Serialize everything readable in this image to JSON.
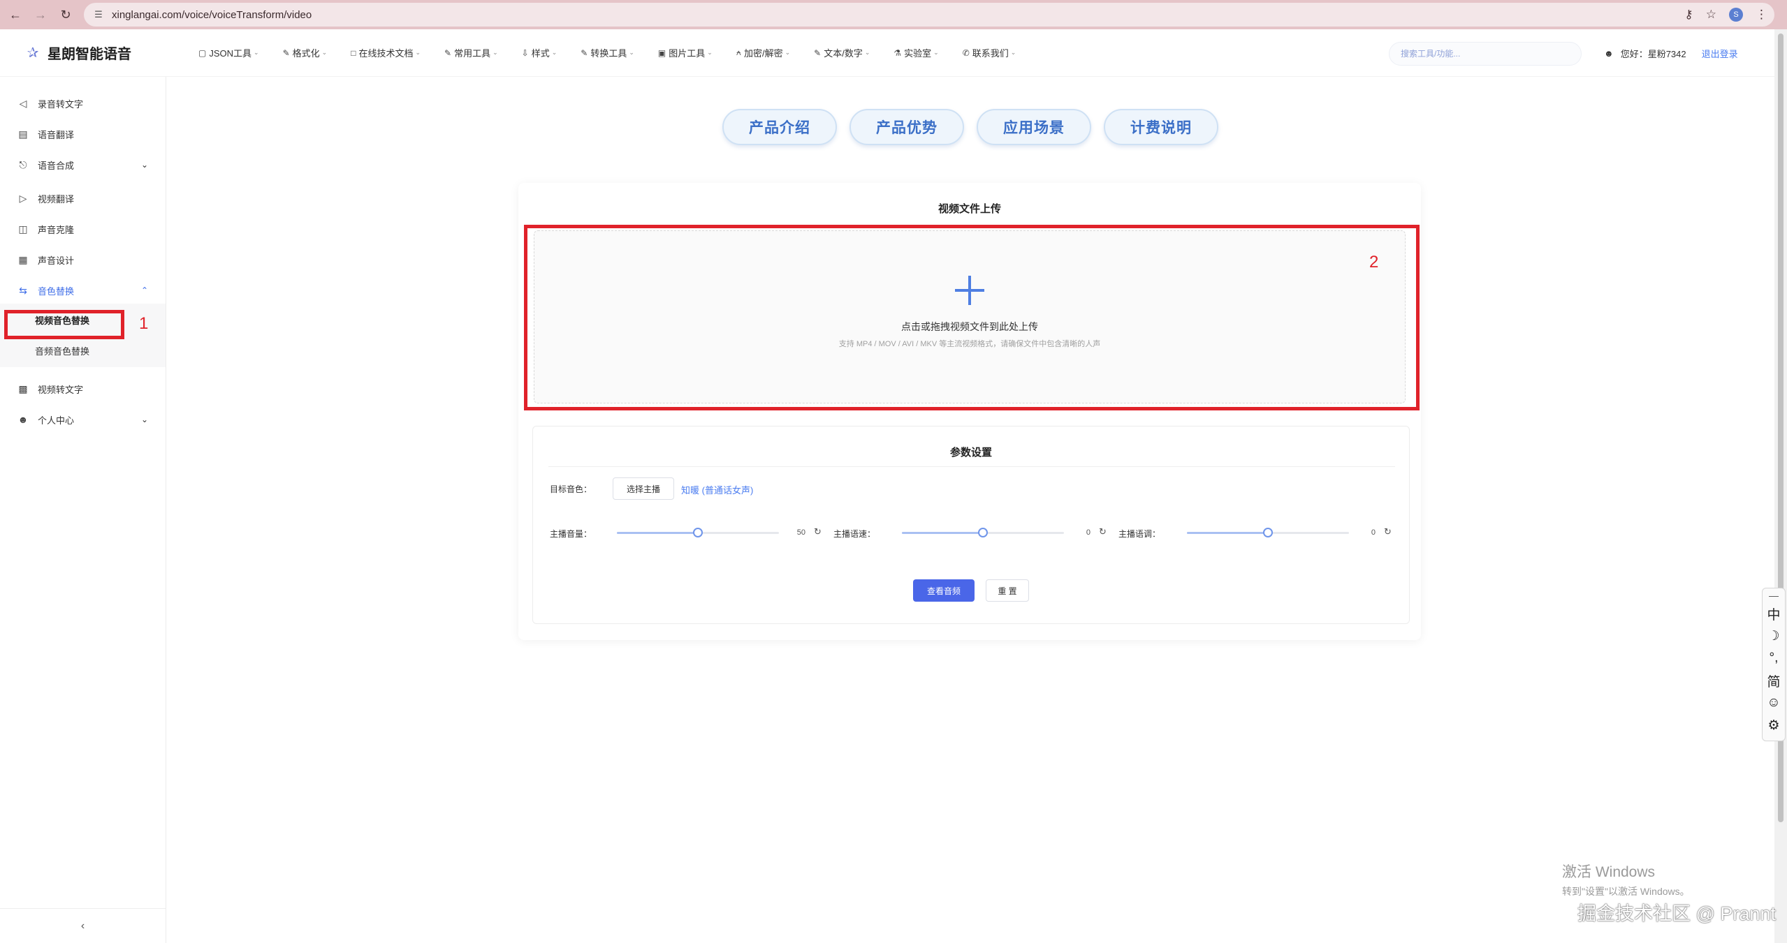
{
  "browser": {
    "url": "xinglangai.com/voice/voiceTransform/video",
    "profile_initial": "S"
  },
  "header": {
    "logo_text": "星朗智能语音",
    "nav": [
      {
        "label": "JSON工具",
        "icon": "json-icon"
      },
      {
        "label": "格式化",
        "icon": "format-icon"
      },
      {
        "label": "在线技术文档",
        "icon": "doc-icon"
      },
      {
        "label": "常用工具",
        "icon": "tools-icon"
      },
      {
        "label": "样式",
        "icon": "style-icon"
      },
      {
        "label": "转换工具",
        "icon": "convert-icon"
      },
      {
        "label": "图片工具",
        "icon": "image-icon"
      },
      {
        "label": "加密/解密",
        "icon": "lock-icon"
      },
      {
        "label": "文本/数字",
        "icon": "text-icon"
      },
      {
        "label": "实验室",
        "icon": "lab-icon"
      },
      {
        "label": "联系我们",
        "icon": "contact-icon"
      }
    ],
    "search_placeholder": "搜索工具/功能...",
    "greeting": "您好：星粉7342",
    "logout": "退出登录"
  },
  "sidebar": {
    "items": [
      {
        "label": "录音转文字",
        "icon": "speaker-icon"
      },
      {
        "label": "语音翻译",
        "icon": "translate-icon"
      },
      {
        "label": "语音合成",
        "icon": "microphone-icon"
      },
      {
        "label": "视频翻译",
        "icon": "video-play-icon"
      },
      {
        "label": "声音克隆",
        "icon": "clone-icon"
      },
      {
        "label": "声音设计",
        "icon": "equalizer-icon"
      },
      {
        "label": "音色替换",
        "icon": "swap-icon"
      },
      {
        "label": "视频转文字",
        "icon": "video-camera-icon"
      },
      {
        "label": "个人中心",
        "icon": "user-icon"
      }
    ],
    "sub_items": [
      {
        "label": "视频音色替换"
      },
      {
        "label": "音频音色替换"
      }
    ],
    "collapse_icon": "chevron-left-icon"
  },
  "annotations": {
    "box1": "1",
    "box2": "2"
  },
  "tabs": [
    {
      "label": "产品介绍"
    },
    {
      "label": "产品优势"
    },
    {
      "label": "应用场景"
    },
    {
      "label": "计费说明"
    }
  ],
  "upload": {
    "title": "视频文件上传",
    "main_text": "点击或拖拽视频文件到此处上传",
    "hint": "支持 MP4 / MOV / AVI / MKV 等主流视频格式，请确保文件中包含清晰的人声"
  },
  "params": {
    "title": "参数设置",
    "target_label": "目标音色：",
    "select_button": "选择主播",
    "voice_name": "知暖 (普通话女声)",
    "sliders": [
      {
        "label": "主播音量：",
        "value": "50",
        "fraction": 0.5
      },
      {
        "label": "主播语速：",
        "value": "0",
        "fraction": 0.5
      },
      {
        "label": "主播语调：",
        "value": "0",
        "fraction": 0.5
      }
    ],
    "primary_button": "查看音频",
    "reset_button": "重 置"
  },
  "ime": [
    "中",
    "☽",
    "°,",
    "简",
    "☺",
    "⚙"
  ],
  "watermark": {
    "windows_line1": "激活 Windows",
    "windows_line2": "转到\"设置\"以激活 Windows。",
    "site": "掘金技术社区 @ Prannt"
  }
}
